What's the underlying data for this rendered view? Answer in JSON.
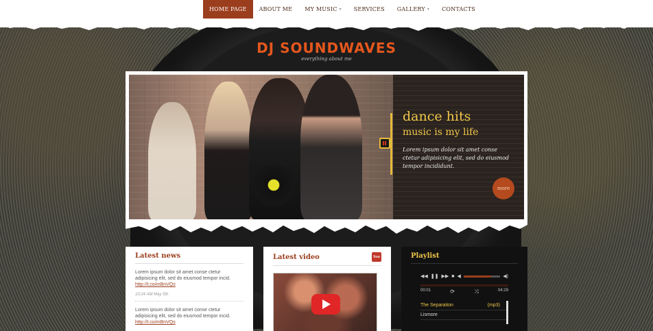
{
  "nav": {
    "items": [
      {
        "label": "HOME PAGE",
        "active": true,
        "dropdown": false
      },
      {
        "label": "ABOUT ME",
        "active": false,
        "dropdown": false
      },
      {
        "label": "MY MUSIC",
        "active": false,
        "dropdown": true
      },
      {
        "label": "SERVICES",
        "active": false,
        "dropdown": false
      },
      {
        "label": "GALLERY",
        "active": false,
        "dropdown": true
      },
      {
        "label": "CONTACTS",
        "active": false,
        "dropdown": false
      }
    ]
  },
  "logo": {
    "title": "DJ SOUNDWAVES",
    "subtitle": "everything about me"
  },
  "slider": {
    "heading": "dance hits",
    "subheading": "music is my life",
    "text": "Lorem ipsum dolor sit amet conse ctetur adipisicing elit, sed do eiusmod tempor incididunt.",
    "more_label": "more",
    "dots": 4,
    "active_dot": 0
  },
  "news": {
    "title": "Latest news",
    "items": [
      {
        "text": "Lorem ipsum dolor sit amet conse ctetur adipisicing elit, sed do eiusmod tempor incid.",
        "link": "http://t.co/mBnVQs",
        "time": "10:24 AM May 5th"
      },
      {
        "text": "Lorem ipsum dolor sit amet conse ctetur adipisicing elit, sed do eiusmod tempor incid.",
        "link": "http://t.co/mBnVQs",
        "time": ""
      }
    ]
  },
  "video": {
    "title": "Latest video",
    "icon": "youtube-icon",
    "icon_label": "You Tube"
  },
  "playlist": {
    "title": "Playlist",
    "time_current": "00:01",
    "time_total": "04:29",
    "progress": 0.75,
    "tracks": [
      {
        "name": "The Separation",
        "tag": "(mp3)",
        "active": true
      },
      {
        "name": "Lismore",
        "tag": "",
        "active": false
      }
    ]
  },
  "colors": {
    "accent": "#9b3e1d",
    "logo": "#e5571d",
    "headline": "#f0c74a"
  }
}
